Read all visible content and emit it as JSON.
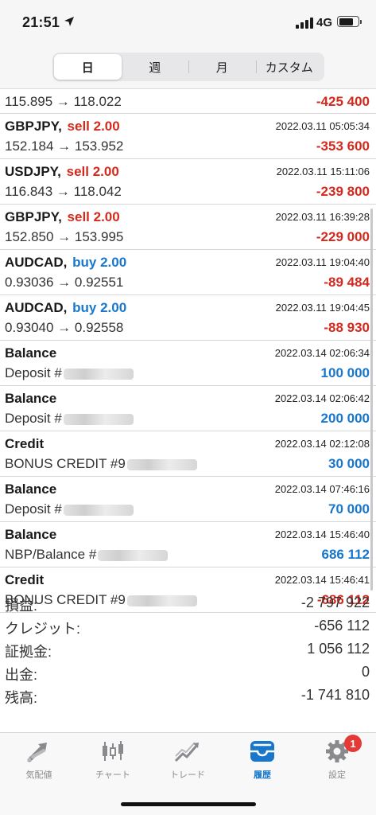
{
  "status_bar": {
    "time": "21:51",
    "network": "4G"
  },
  "segments": [
    {
      "label": "日",
      "active": true
    },
    {
      "label": "週",
      "active": false
    },
    {
      "label": "月",
      "active": false
    },
    {
      "label": "カスタム",
      "active": false
    }
  ],
  "history": {
    "partial_row": {
      "prices": "115.895 → 118.022",
      "amount": "-425 400"
    },
    "trades": [
      {
        "symbol": "GBPJPY,",
        "action": "sell 2.00",
        "datetime": "2022.03.11 05:05:34",
        "prices": "152.184 → 153.952",
        "amount": "-353 600"
      },
      {
        "symbol": "USDJPY,",
        "action": "sell 2.00",
        "datetime": "2022.03.11 15:11:06",
        "prices": "116.843 → 118.042",
        "amount": "-239 800"
      },
      {
        "symbol": "GBPJPY,",
        "action": "sell 2.00",
        "datetime": "2022.03.11 16:39:28",
        "prices": "152.850 → 153.995",
        "amount": "-229 000"
      },
      {
        "symbol": "AUDCAD,",
        "action": "buy 2.00",
        "datetime": "2022.03.11 19:04:40",
        "prices": "0.93036 → 0.92551",
        "amount": "-89 484"
      },
      {
        "symbol": "AUDCAD,",
        "action": "buy 2.00",
        "datetime": "2022.03.11 19:04:45",
        "prices": "0.93040 → 0.92558",
        "amount": "-88 930"
      }
    ],
    "operations": [
      {
        "type": "Balance",
        "datetime": "2022.03.14 02:06:34",
        "comment": "Deposit #",
        "amount": "100 000"
      },
      {
        "type": "Balance",
        "datetime": "2022.03.14 02:06:42",
        "comment": "Deposit #",
        "amount": "200 000"
      },
      {
        "type": "Credit",
        "datetime": "2022.03.14 02:12:08",
        "comment": "BONUS CREDIT #9",
        "amount": "30 000"
      },
      {
        "type": "Balance",
        "datetime": "2022.03.14 07:46:16",
        "comment": "Deposit #",
        "amount": "70 000"
      },
      {
        "type": "Balance",
        "datetime": "2022.03.14 15:46:40",
        "comment": "NBP/Balance #",
        "amount": "686 112"
      },
      {
        "type": "Credit",
        "datetime": "2022.03.14 15:46:41",
        "comment": "BONUS CREDIT #9",
        "amount": "-686 112"
      }
    ]
  },
  "summary": [
    {
      "label": "損益:",
      "value": "-2 797 922"
    },
    {
      "label": "クレジット:",
      "value": "-656 112"
    },
    {
      "label": "証拠金:",
      "value": "1 056 112"
    },
    {
      "label": "出金:",
      "value": "0"
    },
    {
      "label": "残高:",
      "value": "-1 741 810"
    }
  ],
  "colors": {
    "loss": "#d42a1e",
    "profit": "#1877cc",
    "active_tab": "#1877cc",
    "badge": "#e53935"
  },
  "tab_bar": {
    "tabs": [
      {
        "label": "気配値",
        "icon": "quotes-arrows-icon"
      },
      {
        "label": "チャート",
        "icon": "candlestick-chart-icon"
      },
      {
        "label": "トレード",
        "icon": "trade-line-chart-icon"
      },
      {
        "label": "履歴",
        "icon": "history-inbox-icon",
        "active": true
      },
      {
        "label": "設定",
        "icon": "gear-icon",
        "badge": "1"
      }
    ]
  }
}
